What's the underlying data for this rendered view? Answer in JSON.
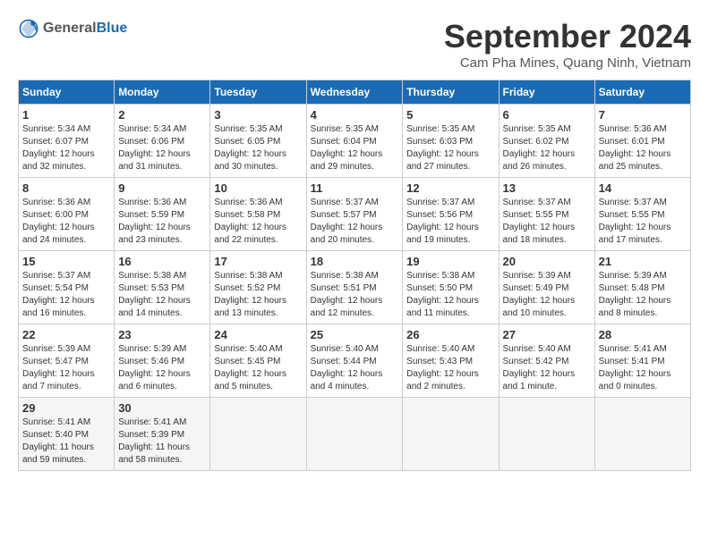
{
  "header": {
    "logo_general": "General",
    "logo_blue": "Blue",
    "title": "September 2024",
    "location": "Cam Pha Mines, Quang Ninh, Vietnam"
  },
  "calendar": {
    "headers": [
      "Sunday",
      "Monday",
      "Tuesday",
      "Wednesday",
      "Thursday",
      "Friday",
      "Saturday"
    ],
    "weeks": [
      [
        {
          "day": "1",
          "info": "Sunrise: 5:34 AM\nSunset: 6:07 PM\nDaylight: 12 hours\nand 32 minutes."
        },
        {
          "day": "2",
          "info": "Sunrise: 5:34 AM\nSunset: 6:06 PM\nDaylight: 12 hours\nand 31 minutes."
        },
        {
          "day": "3",
          "info": "Sunrise: 5:35 AM\nSunset: 6:05 PM\nDaylight: 12 hours\nand 30 minutes."
        },
        {
          "day": "4",
          "info": "Sunrise: 5:35 AM\nSunset: 6:04 PM\nDaylight: 12 hours\nand 29 minutes."
        },
        {
          "day": "5",
          "info": "Sunrise: 5:35 AM\nSunset: 6:03 PM\nDaylight: 12 hours\nand 27 minutes."
        },
        {
          "day": "6",
          "info": "Sunrise: 5:35 AM\nSunset: 6:02 PM\nDaylight: 12 hours\nand 26 minutes."
        },
        {
          "day": "7",
          "info": "Sunrise: 5:36 AM\nSunset: 6:01 PM\nDaylight: 12 hours\nand 25 minutes."
        }
      ],
      [
        {
          "day": "8",
          "info": "Sunrise: 5:36 AM\nSunset: 6:00 PM\nDaylight: 12 hours\nand 24 minutes."
        },
        {
          "day": "9",
          "info": "Sunrise: 5:36 AM\nSunset: 5:59 PM\nDaylight: 12 hours\nand 23 minutes."
        },
        {
          "day": "10",
          "info": "Sunrise: 5:36 AM\nSunset: 5:58 PM\nDaylight: 12 hours\nand 22 minutes."
        },
        {
          "day": "11",
          "info": "Sunrise: 5:37 AM\nSunset: 5:57 PM\nDaylight: 12 hours\nand 20 minutes."
        },
        {
          "day": "12",
          "info": "Sunrise: 5:37 AM\nSunset: 5:56 PM\nDaylight: 12 hours\nand 19 minutes."
        },
        {
          "day": "13",
          "info": "Sunrise: 5:37 AM\nSunset: 5:55 PM\nDaylight: 12 hours\nand 18 minutes."
        },
        {
          "day": "14",
          "info": "Sunrise: 5:37 AM\nSunset: 5:55 PM\nDaylight: 12 hours\nand 17 minutes."
        }
      ],
      [
        {
          "day": "15",
          "info": "Sunrise: 5:37 AM\nSunset: 5:54 PM\nDaylight: 12 hours\nand 16 minutes."
        },
        {
          "day": "16",
          "info": "Sunrise: 5:38 AM\nSunset: 5:53 PM\nDaylight: 12 hours\nand 14 minutes."
        },
        {
          "day": "17",
          "info": "Sunrise: 5:38 AM\nSunset: 5:52 PM\nDaylight: 12 hours\nand 13 minutes."
        },
        {
          "day": "18",
          "info": "Sunrise: 5:38 AM\nSunset: 5:51 PM\nDaylight: 12 hours\nand 12 minutes."
        },
        {
          "day": "19",
          "info": "Sunrise: 5:38 AM\nSunset: 5:50 PM\nDaylight: 12 hours\nand 11 minutes."
        },
        {
          "day": "20",
          "info": "Sunrise: 5:39 AM\nSunset: 5:49 PM\nDaylight: 12 hours\nand 10 minutes."
        },
        {
          "day": "21",
          "info": "Sunrise: 5:39 AM\nSunset: 5:48 PM\nDaylight: 12 hours\nand 8 minutes."
        }
      ],
      [
        {
          "day": "22",
          "info": "Sunrise: 5:39 AM\nSunset: 5:47 PM\nDaylight: 12 hours\nand 7 minutes."
        },
        {
          "day": "23",
          "info": "Sunrise: 5:39 AM\nSunset: 5:46 PM\nDaylight: 12 hours\nand 6 minutes."
        },
        {
          "day": "24",
          "info": "Sunrise: 5:40 AM\nSunset: 5:45 PM\nDaylight: 12 hours\nand 5 minutes."
        },
        {
          "day": "25",
          "info": "Sunrise: 5:40 AM\nSunset: 5:44 PM\nDaylight: 12 hours\nand 4 minutes."
        },
        {
          "day": "26",
          "info": "Sunrise: 5:40 AM\nSunset: 5:43 PM\nDaylight: 12 hours\nand 2 minutes."
        },
        {
          "day": "27",
          "info": "Sunrise: 5:40 AM\nSunset: 5:42 PM\nDaylight: 12 hours\nand 1 minute."
        },
        {
          "day": "28",
          "info": "Sunrise: 5:41 AM\nSunset: 5:41 PM\nDaylight: 12 hours\nand 0 minutes."
        }
      ],
      [
        {
          "day": "29",
          "info": "Sunrise: 5:41 AM\nSunset: 5:40 PM\nDaylight: 11 hours\nand 59 minutes."
        },
        {
          "day": "30",
          "info": "Sunrise: 5:41 AM\nSunset: 5:39 PM\nDaylight: 11 hours\nand 58 minutes."
        },
        {
          "day": "",
          "info": ""
        },
        {
          "day": "",
          "info": ""
        },
        {
          "day": "",
          "info": ""
        },
        {
          "day": "",
          "info": ""
        },
        {
          "day": "",
          "info": ""
        }
      ]
    ]
  }
}
